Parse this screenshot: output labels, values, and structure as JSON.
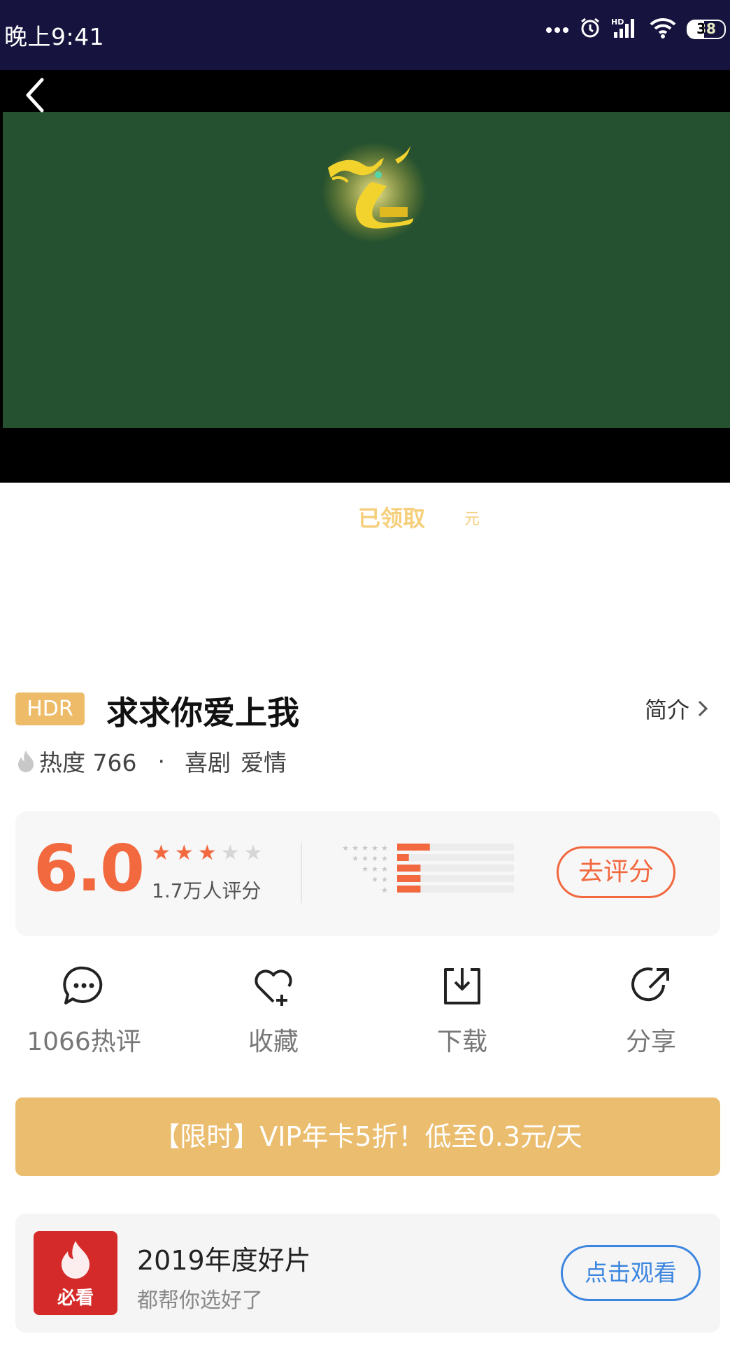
{
  "status_bar": {
    "time": "晚上9:41",
    "battery": "38"
  },
  "video": {},
  "promo": {
    "claimed": "已领取",
    "yuan": "元"
  },
  "movie": {
    "badge": "HDR",
    "title": "求求你爱上我",
    "intro_label": "简介",
    "heat_label": "热度 766",
    "separator": "·",
    "genres": [
      "喜剧",
      "爱情"
    ]
  },
  "rating": {
    "score": "6.0",
    "stars_filled": 3,
    "stars_total": 5,
    "count": "1.7万人评分",
    "rate_button": "去评分",
    "distribution": [
      0.28,
      0.1,
      0.2,
      0.2,
      0.2
    ],
    "accent_color": "#f2683f"
  },
  "actions": [
    {
      "label": "1066热评",
      "icon": "comment-icon"
    },
    {
      "label": "收藏",
      "icon": "heart-plus-icon"
    },
    {
      "label": "下载",
      "icon": "download-icon"
    },
    {
      "label": "分享",
      "icon": "share-icon"
    }
  ],
  "vip_banner": {
    "text": "【限时】VIP年卡5折！低至0.3元/天"
  },
  "recommend": {
    "poster_tag": "必看",
    "title": "2019年度好片",
    "subtitle": "都帮你选好了",
    "button": "点击观看"
  }
}
